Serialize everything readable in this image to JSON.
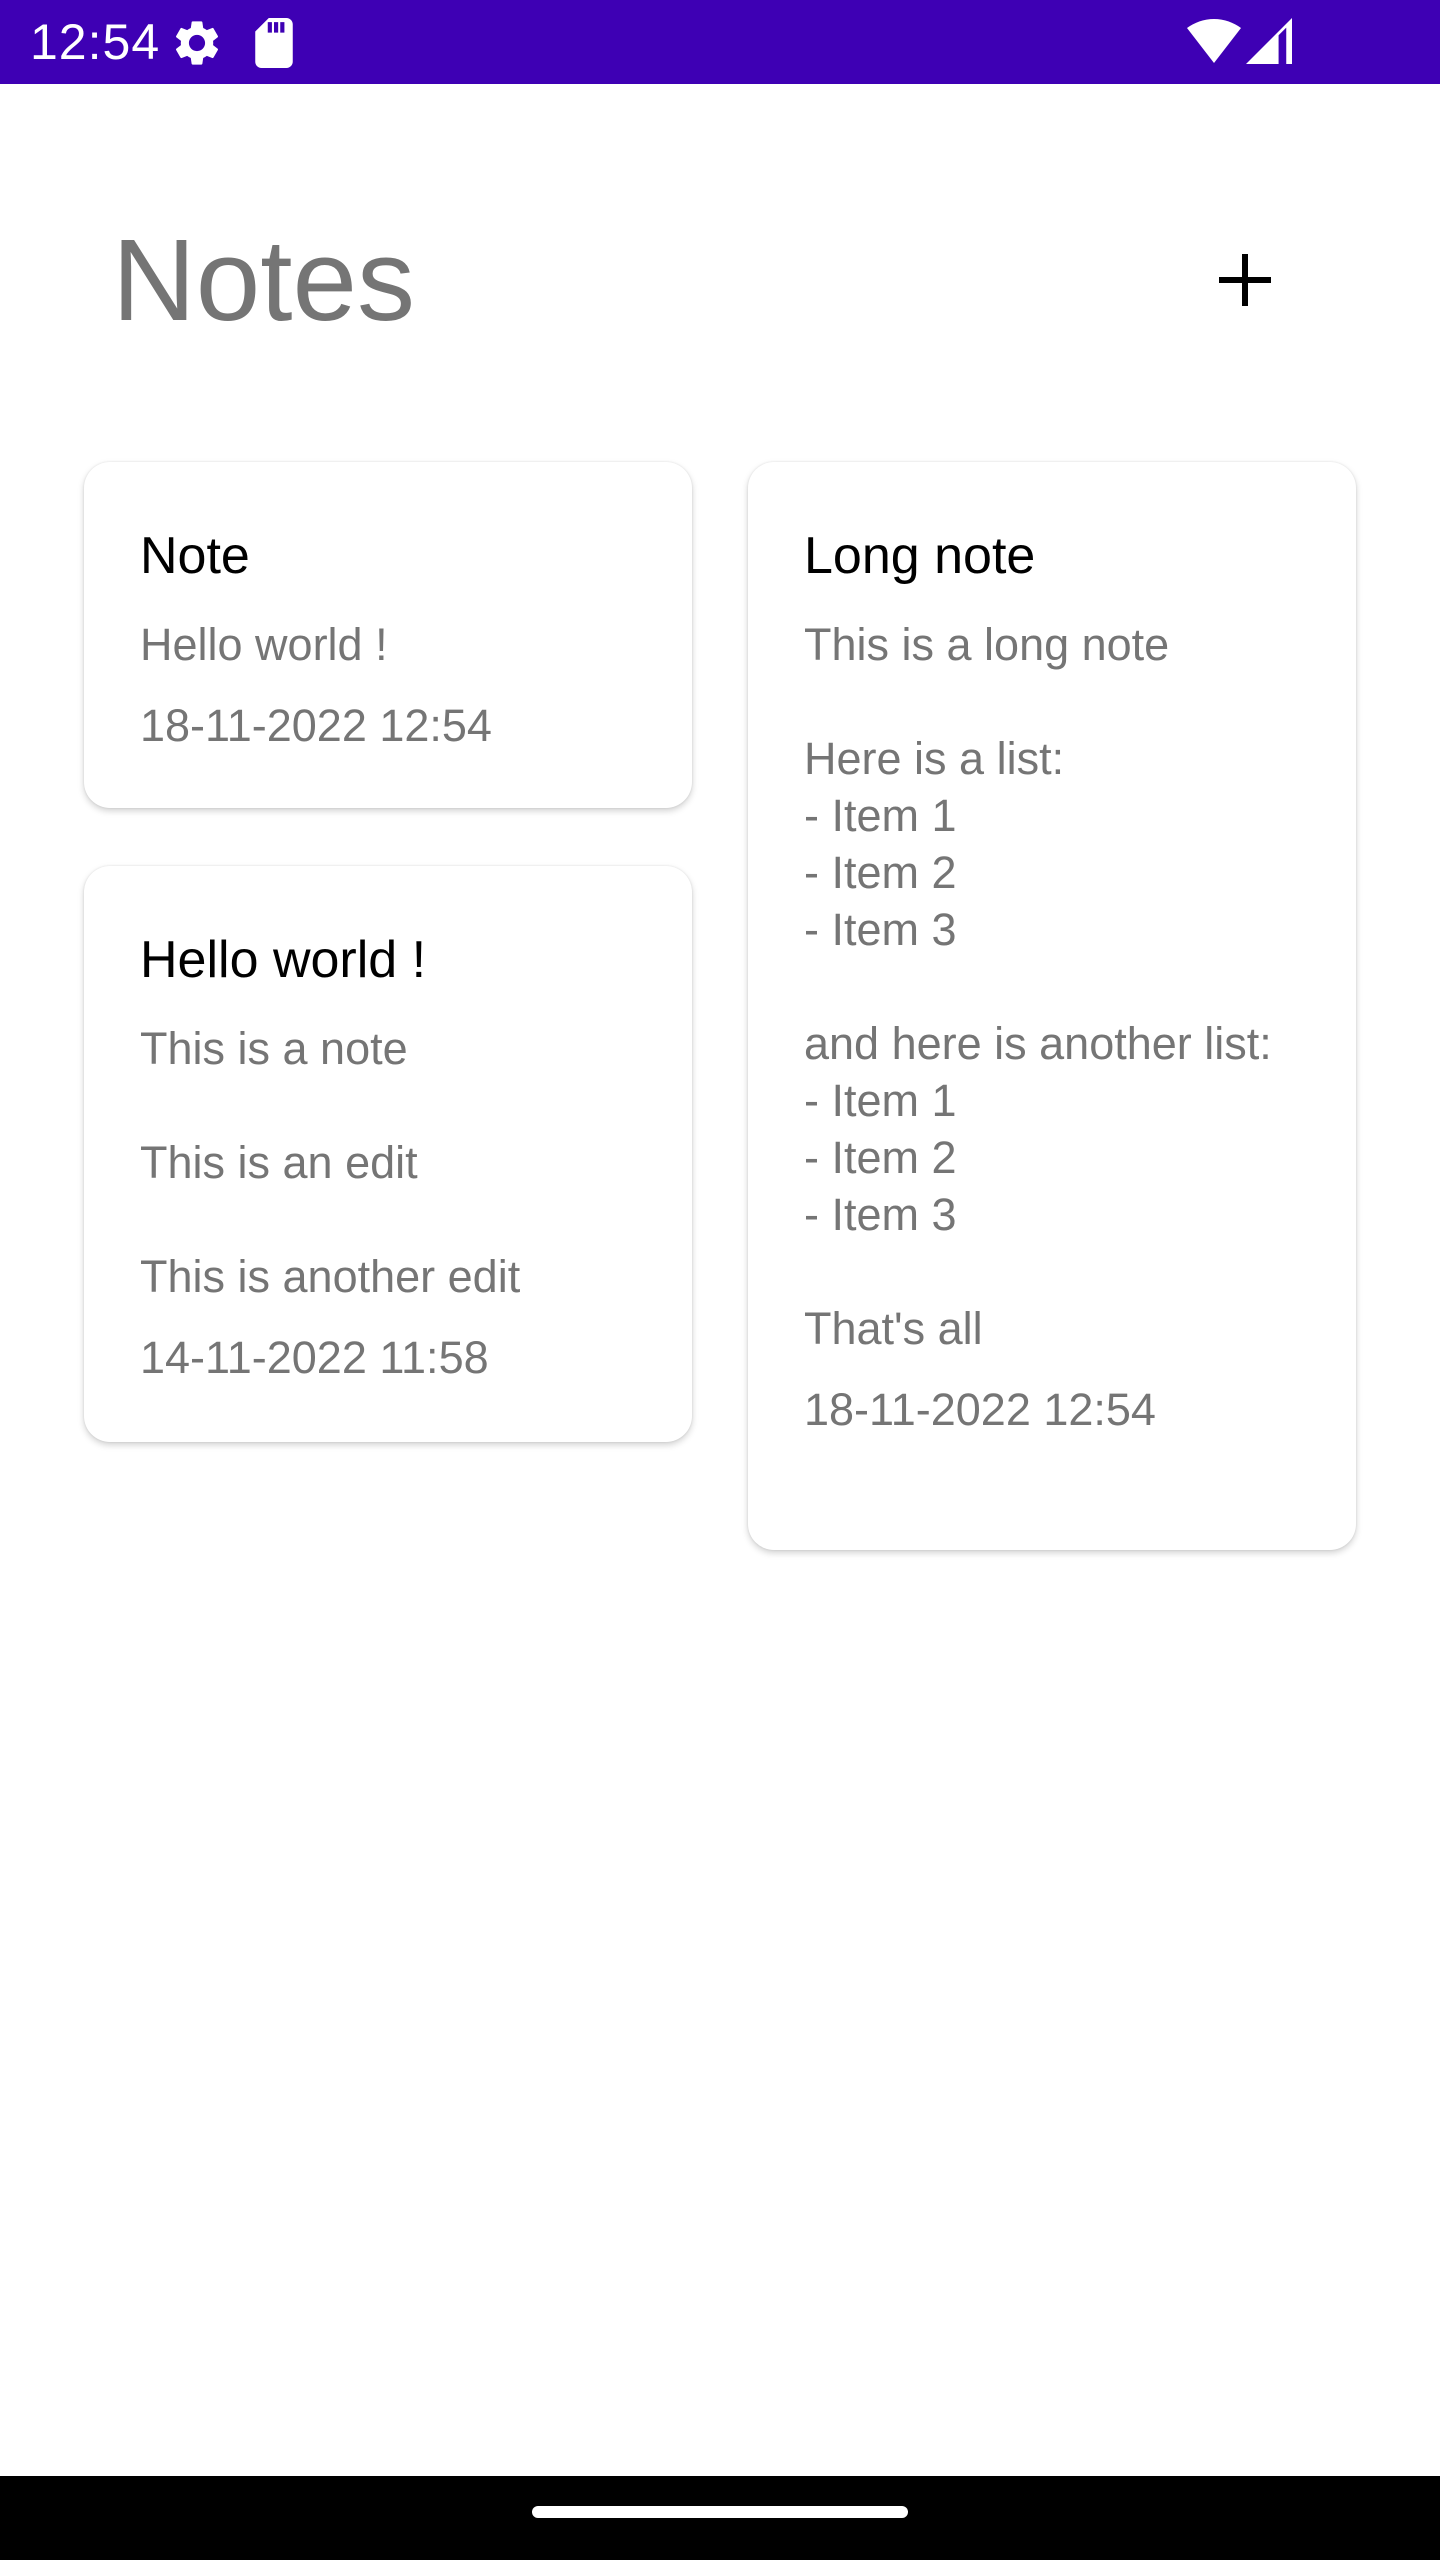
{
  "status_bar": {
    "time": "12:54",
    "background_color": "#3E00B4",
    "left_icons": [
      "settings-gear-icon",
      "sd-card-icon"
    ],
    "right_icons": [
      "wifi-icon",
      "cell-signal-icon"
    ]
  },
  "header": {
    "title": "Notes",
    "add_icon": "plus-icon"
  },
  "notes": [
    {
      "title": "Note",
      "body": "Hello world !",
      "date": "18-11-2022 12:54"
    },
    {
      "title": "Long note",
      "body": "This is a long note\n\nHere is a list:\n- Item 1\n- Item 2\n- Item 3\n\nand here is another list:\n- Item 1\n- Item 2\n- Item 3\n\nThat's all",
      "date": "18-11-2022 12:54"
    },
    {
      "title": "Hello world !",
      "body": "This is a note\n\nThis is an edit\n\nThis is another edit",
      "date": "14-11-2022 11:58"
    }
  ],
  "nav_bar": {
    "handle": "home-gesture-handle"
  }
}
